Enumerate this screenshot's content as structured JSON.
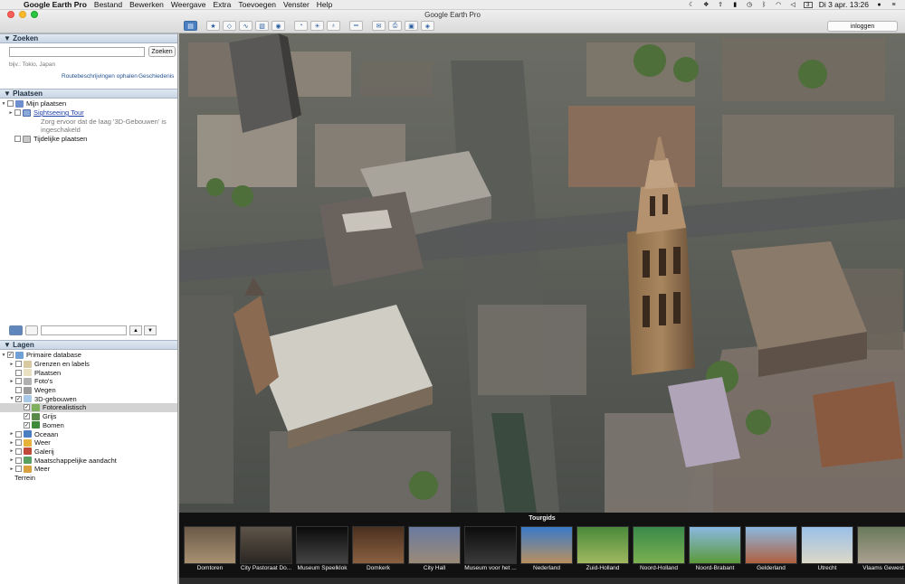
{
  "menubar": {
    "app": "Google Earth Pro",
    "items": [
      "Bestand",
      "Bewerken",
      "Weergave",
      "Extra",
      "Toevoegen",
      "Venster",
      "Help"
    ],
    "clock": "Di 3 apr.  13:26",
    "badge": "3"
  },
  "window": {
    "title": "Google Earth Pro",
    "login_label": "inloggen"
  },
  "search": {
    "header": "Zoeken",
    "button": "Zoeken",
    "placeholder": "bijv.: Tokio, Japan",
    "link_routes": "Routebeschrijvingen ophalen",
    "link_history": "Geschiedenis"
  },
  "places": {
    "header": "Plaatsen",
    "my_places": "Mijn plaatsen",
    "tour": "Sightseeing Tour",
    "note_line1": "Zorg ervoor dat de laag '3D-Gebouwen' is",
    "note_line2": "ingeschakeld",
    "temp": "Tijdelijke plaatsen"
  },
  "layers": {
    "header": "Lagen",
    "items": [
      {
        "label": "Primaire database",
        "level": 0,
        "tri": "▼",
        "checked": true,
        "icon": "globe-icon",
        "color": "#6fa0d8"
      },
      {
        "label": "Grenzen en labels",
        "level": 1,
        "tri": "►",
        "checked": false,
        "icon": "borders-icon",
        "color": "#d9c9a0"
      },
      {
        "label": "Plaatsen",
        "level": 1,
        "tri": "",
        "checked": false,
        "icon": "places-icon",
        "color": "#e8e0c0"
      },
      {
        "label": "Foto's",
        "level": 1,
        "tri": "►",
        "checked": false,
        "icon": "photo-icon",
        "color": "#b0b0b0"
      },
      {
        "label": "Wegen",
        "level": 1,
        "tri": "",
        "checked": false,
        "icon": "roads-icon",
        "color": "#9a9a9a"
      },
      {
        "label": "3D-gebouwen",
        "level": 1,
        "tri": "▼",
        "checked": true,
        "icon": "buildings-icon",
        "color": "#a8c8e8"
      },
      {
        "label": "Fotorealistisch",
        "level": 2,
        "tri": "",
        "checked": true,
        "icon": "photoreal-icon",
        "color": "#7fb060",
        "selected": true
      },
      {
        "label": "Grijs",
        "level": 2,
        "tri": "",
        "checked": true,
        "icon": "gray-icon",
        "color": "#5a8a4a"
      },
      {
        "label": "Bomen",
        "level": 2,
        "tri": "",
        "checked": true,
        "icon": "trees-icon",
        "color": "#3f8a3a"
      },
      {
        "label": "Oceaan",
        "level": 1,
        "tri": "►",
        "checked": false,
        "icon": "ocean-icon",
        "color": "#4a7fc1"
      },
      {
        "label": "Weer",
        "level": 1,
        "tri": "►",
        "checked": false,
        "icon": "weather-icon",
        "color": "#e5b23a"
      },
      {
        "label": "Galerij",
        "level": 1,
        "tri": "►",
        "checked": false,
        "icon": "gallery-icon",
        "color": "#c04a3a"
      },
      {
        "label": "Maatschappelijke aandacht",
        "level": 1,
        "tri": "►",
        "checked": false,
        "icon": "awareness-icon",
        "color": "#5aa060"
      },
      {
        "label": "Meer",
        "level": 1,
        "tri": "►",
        "checked": false,
        "icon": "more-icon",
        "color": "#d9a040"
      },
      {
        "label": "Terrein",
        "level": 0,
        "tri": "",
        "checked": false,
        "icon": "",
        "color": ""
      }
    ]
  },
  "tour": {
    "title": "Tourgids",
    "items": [
      {
        "label": "Domtoren",
        "c1": "#6b5a48",
        "c2": "#a89070"
      },
      {
        "label": "City Pastoraat Do...",
        "c1": "#5e5448",
        "c2": "#2a2622"
      },
      {
        "label": "Museum Speelklok",
        "c1": "#0b0b0b",
        "c2": "#444444"
      },
      {
        "label": "Domkerk",
        "c1": "#4a3020",
        "c2": "#8a6040"
      },
      {
        "label": "City Hall",
        "c1": "#6a7aa0",
        "c2": "#9a8a78"
      },
      {
        "label": "Museum voor het ...",
        "c1": "#0c0c0c",
        "c2": "#3a3a3a"
      },
      {
        "label": "Nederland",
        "c1": "#3a7ac8",
        "c2": "#b89060"
      },
      {
        "label": "Zuid-Holland",
        "c1": "#4a8a3a",
        "c2": "#a0b860"
      },
      {
        "label": "Noord-Holland",
        "c1": "#3a8a4a",
        "c2": "#7ab050"
      },
      {
        "label": "Noord-Brabant",
        "c1": "#8ab8e0",
        "c2": "#5a9a3a"
      },
      {
        "label": "Gelderland",
        "c1": "#8ab8e0",
        "c2": "#b06040"
      },
      {
        "label": "Utrecht",
        "c1": "#9ac0e8",
        "c2": "#ddd8c8"
      },
      {
        "label": "Vlaams Gewest",
        "c1": "#6a7a5a",
        "c2": "#aaa090"
      }
    ]
  }
}
